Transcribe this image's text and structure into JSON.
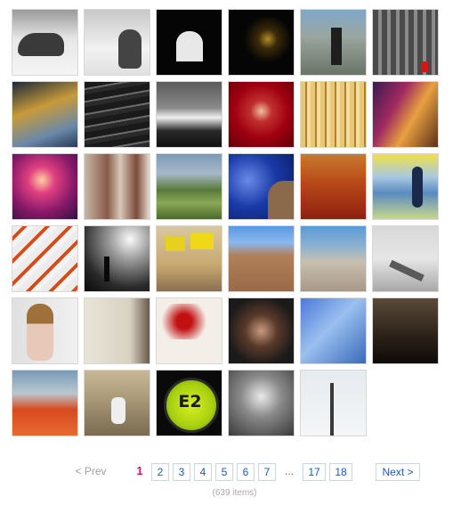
{
  "gallery": {
    "thumbnails": [
      {
        "subject": "photo-whale-sculpture"
      },
      {
        "subject": "photo-snow-figures"
      },
      {
        "subject": "photo-white-chapel-night"
      },
      {
        "subject": "photo-dark-night-scene"
      },
      {
        "subject": "photo-street-figure"
      },
      {
        "subject": "photo-fire-escape"
      },
      {
        "subject": "photo-golden-lines"
      },
      {
        "subject": "photo-dark-texture"
      },
      {
        "subject": "photo-seashore-waves"
      },
      {
        "subject": "photo-red-portrait"
      },
      {
        "subject": "photo-yellow-stripes"
      },
      {
        "subject": "photo-colorful-street"
      },
      {
        "subject": "photo-pink-dancer"
      },
      {
        "subject": "photo-vases"
      },
      {
        "subject": "photo-green-valley"
      },
      {
        "subject": "photo-blue-sky-building"
      },
      {
        "subject": "photo-red-carpet-feet"
      },
      {
        "subject": "photo-yellow-field-figure"
      },
      {
        "subject": "photo-orange-stripes"
      },
      {
        "subject": "photo-silhouette-sea"
      },
      {
        "subject": "photo-yellow-flags"
      },
      {
        "subject": "photo-wall-ladder"
      },
      {
        "subject": "photo-city-rooftops"
      },
      {
        "subject": "photo-escalator"
      },
      {
        "subject": "photo-doll"
      },
      {
        "subject": "photo-wall-window"
      },
      {
        "subject": "photo-red-splash"
      },
      {
        "subject": "photo-face-portrait"
      },
      {
        "subject": "photo-blue-tower"
      },
      {
        "subject": "photo-dark-figure"
      },
      {
        "subject": "photo-red-fence"
      },
      {
        "subject": "photo-white-horse"
      },
      {
        "subject": "photo-e2-button",
        "overlay_text": "E2"
      },
      {
        "subject": "photo-old-man"
      },
      {
        "subject": "photo-tv-tower"
      }
    ]
  },
  "pagination": {
    "prev_label": "< Prev",
    "current_page": "1",
    "pages": [
      "2",
      "3",
      "4",
      "5",
      "6",
      "7"
    ],
    "ellipsis": "...",
    "more_pages": [
      "17",
      "18"
    ],
    "next_label": "Next >",
    "item_count": "(639 items)"
  },
  "colors": {
    "link": "#1c58c4",
    "current": "#e0106a",
    "muted": "#a0a0a0"
  }
}
